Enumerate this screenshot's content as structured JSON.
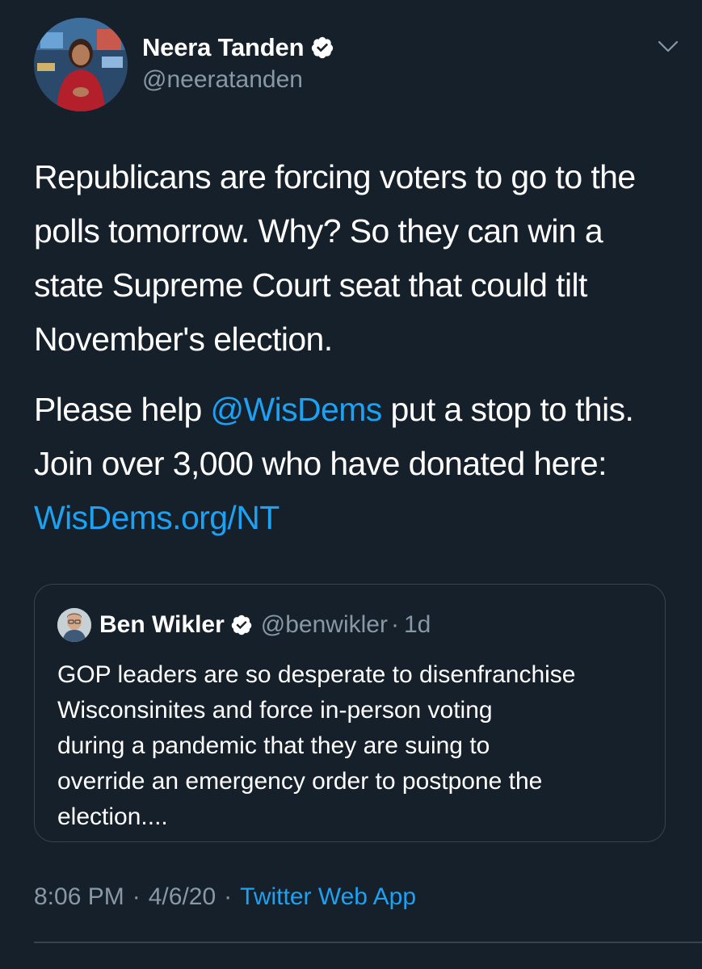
{
  "author": {
    "display_name": "Neera Tanden",
    "handle": "@neeratanden",
    "verified": true
  },
  "icons": {
    "verified": "verified-badge-icon",
    "caret": "chevron-down-icon"
  },
  "tweet": {
    "paragraph1": "Republicans are forcing voters to go to the polls tomorrow. Why? So they can win a state Supreme Court seat that could tilt November's election.",
    "paragraph2_before_mention": "Please help ",
    "mention": "@WisDems",
    "paragraph2_after_mention": " put a stop to this. Join over 3,000 who have donated here: ",
    "link": "WisDems.org/NT"
  },
  "quoted_tweet": {
    "display_name": "Ben Wikler",
    "handle": "@benwikler",
    "separator": "·",
    "time": "1d",
    "text": "GOP leaders are so desperate to disenfranchise\nWisconsinites and force in-person voting\nduring a pandemic that they are suing to\noverride an emergency order to postpone the\nelection...."
  },
  "meta": {
    "time": "8:06 PM",
    "separator": "·",
    "date": "4/6/20",
    "separator2": "·",
    "source": "Twitter Web App"
  },
  "colors": {
    "background": "#15202b",
    "text": "#ffffff",
    "secondary": "#8899a6",
    "accent": "#1da1f2",
    "border": "#38444d"
  }
}
